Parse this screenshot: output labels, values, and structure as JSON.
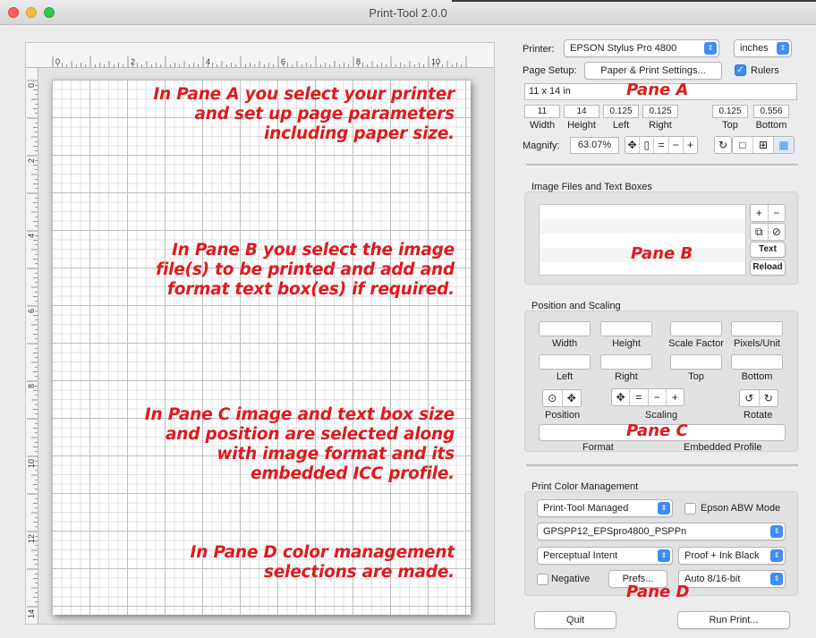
{
  "window": {
    "title": "Print-Tool 2.0.0"
  },
  "ruler": {
    "h_labels": [
      "0",
      "2",
      "4",
      "6",
      "8",
      "10"
    ],
    "v_labels": [
      "0",
      "2",
      "4",
      "6",
      "8",
      "10",
      "12",
      "14"
    ]
  },
  "annotations": [
    "In Pane A you select your printer\nand set up page parameters\nincluding paper size.",
    "In Pane B you select the image\nfile(s) to be printed and add and\nformat text box(es) if required.",
    "In Pane C image and text box size\nand position are selected along\nwith image format and its\nembedded ICC profile.",
    "In Pane D color management\nselections are made."
  ],
  "pane_a": {
    "label": "Pane A",
    "printer_label": "Printer:",
    "printer_value": "EPSON Stylus Pro 4800",
    "units_value": "inches",
    "page_setup_label": "Page Setup:",
    "page_setup_button": "Paper & Print Settings...",
    "rulers_label": "Rulers",
    "rulers_checked": true,
    "paper_size": "11 x 14 in",
    "dims": [
      {
        "value": "11",
        "label": "Width"
      },
      {
        "value": "14",
        "label": "Height"
      },
      {
        "value": "0.125",
        "label": "Left"
      },
      {
        "value": "0.125",
        "label": "Right"
      },
      {
        "value": "0.125",
        "label": "Top"
      },
      {
        "value": "0.556",
        "label": "Bottom"
      }
    ],
    "magnify_label": "Magnify:",
    "magnify_value": "63.07%"
  },
  "pane_b": {
    "label": "Pane B",
    "title": "Image Files and Text Boxes",
    "add": "+",
    "remove": "−",
    "text_button": "Text",
    "reload_button": "Reload"
  },
  "pane_c": {
    "label": "Pane C",
    "title": "Position and Scaling",
    "row1": [
      "Width",
      "Height",
      "Scale Factor",
      "Pixels/Unit"
    ],
    "row2": [
      "Left",
      "Right",
      "Top",
      "Bottom"
    ],
    "position_label": "Position",
    "scaling_label": "Scaling",
    "rotate_label": "Rotate",
    "format_label": "Format",
    "profile_label": "Embedded Profile"
  },
  "pane_d": {
    "label": "Pane D",
    "title": "Print Color Management",
    "mode": "Print-Tool Managed",
    "abw_label": "Epson ABW Mode",
    "abw_checked": false,
    "profile": "GPSPP12_EPSpro4800_PSPPn",
    "intent": "Perceptual Intent",
    "proof": "Proof + Ink Black",
    "negative_label": "Negative",
    "negative_checked": false,
    "prefs_button": "Prefs...",
    "bitdepth": "Auto 8/16-bit"
  },
  "footer": {
    "quit": "Quit",
    "run": "Run Print..."
  },
  "colors": {
    "accent": "#3f8df5",
    "annotation": "#e0191c"
  }
}
